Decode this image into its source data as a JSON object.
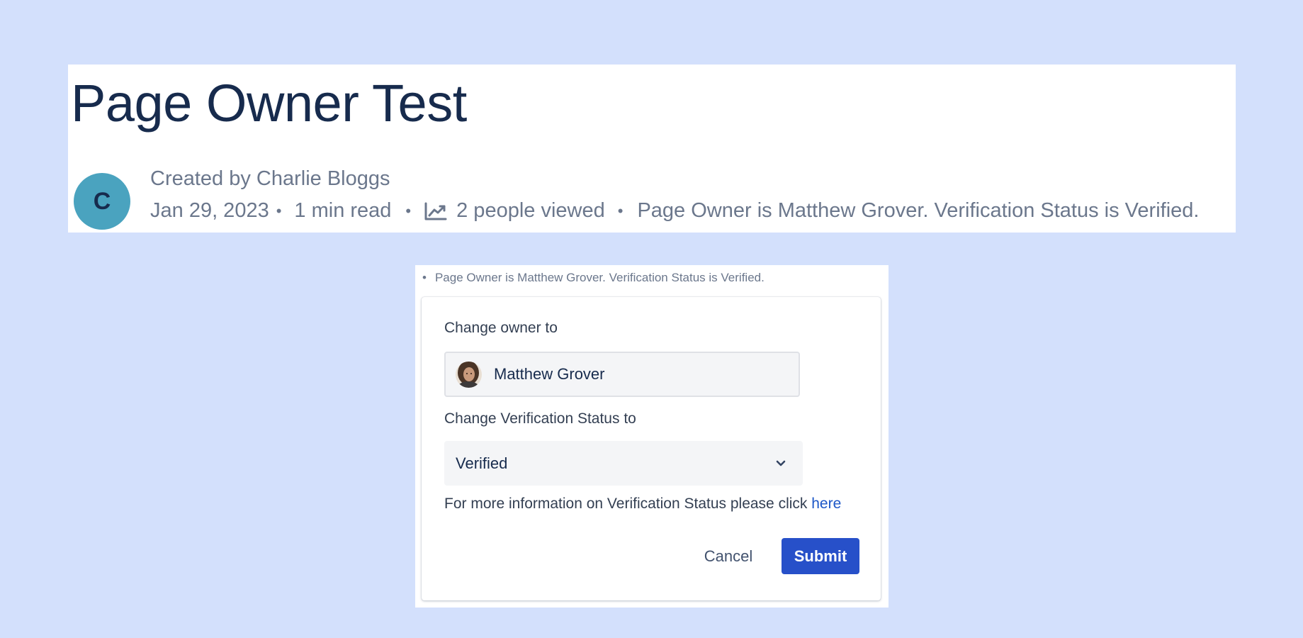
{
  "page": {
    "title": "Page Owner Test"
  },
  "byline": {
    "avatar_initial": "C",
    "created_by": "Created by Charlie Bloggs",
    "date": "Jan 29, 2023",
    "read_time": "1 min read",
    "views": "2 people viewed",
    "owner_status": "Page Owner is Matthew Grover. Verification Status is Verified.",
    "separator": "•",
    "views_icon": "line-chart-icon"
  },
  "dialog": {
    "header_text": "Page Owner is Matthew Grover. Verification Status is Verified.",
    "owner_label": "Change owner to",
    "owner_value": "Matthew Grover",
    "status_label": "Change Verification Status to",
    "status_value": "Verified",
    "status_chevron_icon": "chevron-down-icon",
    "info_text": "For more information on Verification Status please click",
    "info_link": "here",
    "cancel_label": "Cancel",
    "submit_label": "Submit"
  },
  "colors": {
    "background": "#d3e0fc",
    "title": "#172b4d",
    "meta_text": "#6b778c",
    "avatar_bg": "#4aa3bf",
    "submit_bg": "#2750c9",
    "link": "#1d57c7"
  }
}
